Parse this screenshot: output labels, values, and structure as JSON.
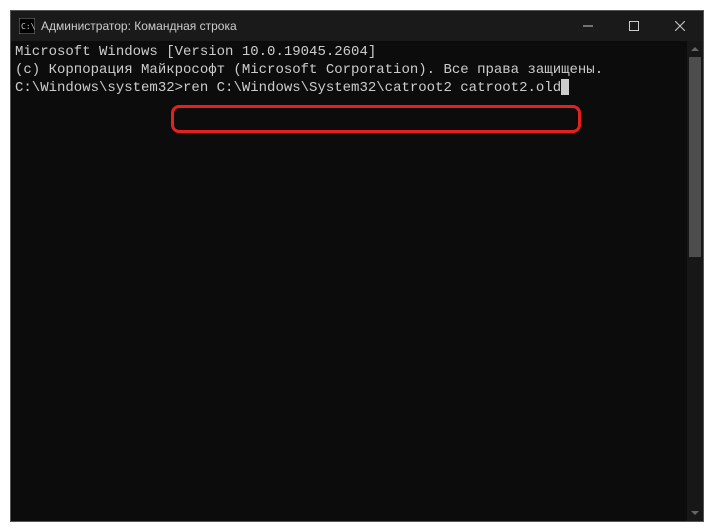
{
  "window": {
    "title": "Администратор: Командная строка"
  },
  "terminal": {
    "line1": "Microsoft Windows [Version 10.0.19045.2604]",
    "line2": "(c) Корпорация Майкрософт (Microsoft Corporation). Все права защищены.",
    "blank": "",
    "prompt": "C:\\Windows\\system32>",
    "command": "ren C:\\Windows\\System32\\catroot2 catroot2.old"
  }
}
